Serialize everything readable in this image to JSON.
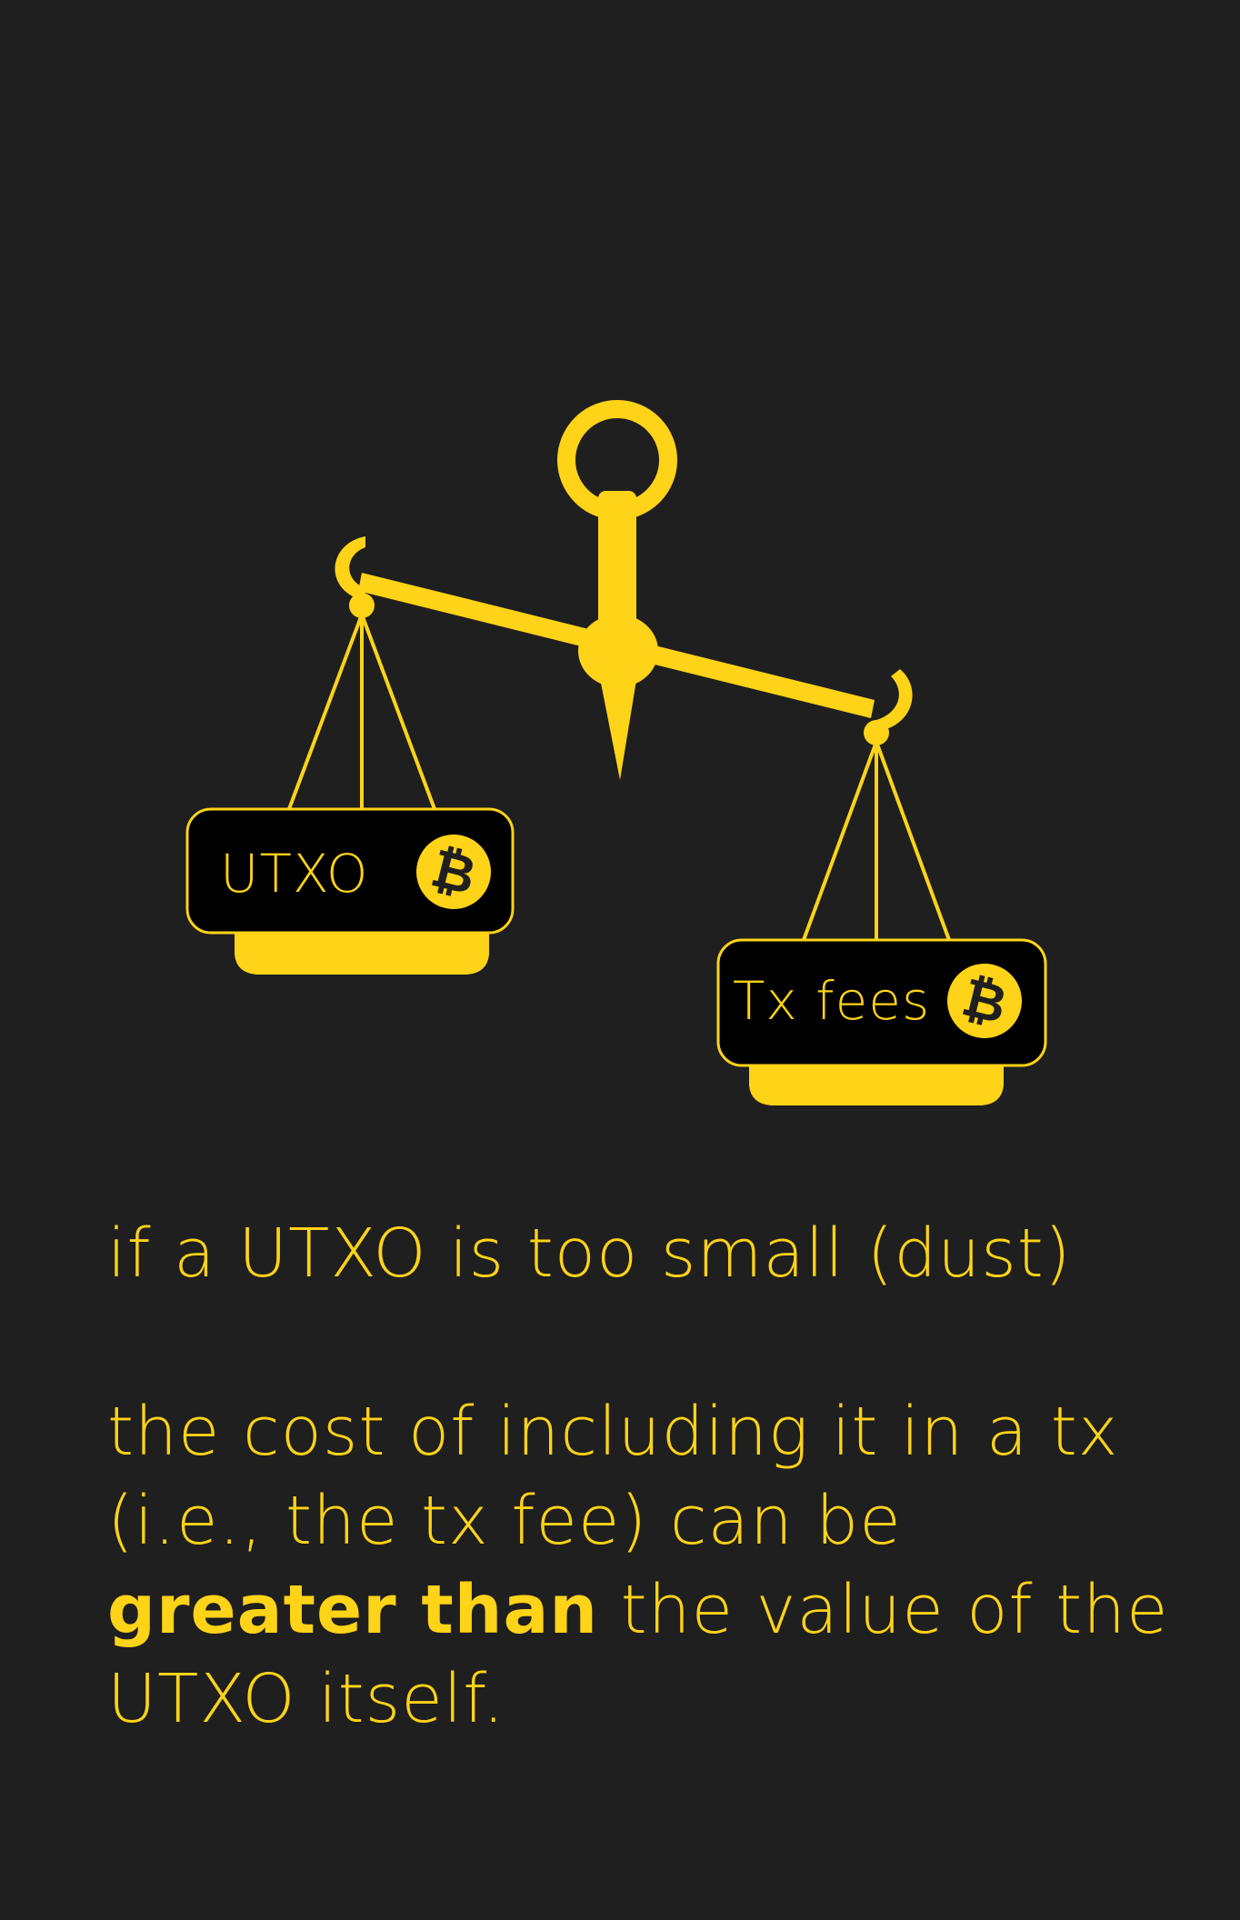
{
  "illustration": {
    "left_pan_label": "UTXO",
    "right_pan_label": "Tx fees",
    "coin_symbol": "₿",
    "icon": "balance-scale-icon",
    "coin_icon": "bitcoin-icon"
  },
  "caption": {
    "line1": "if a UTXO is too small (dust)",
    "para2_lead": "the cost of including it in a tx (i.e., the tx fee) can be",
    "para2_emphasis": "greater than",
    "para2_tail": "the value of the UTXO itself."
  },
  "colors": {
    "background": "#1f1f1f",
    "accent": "#ffd318",
    "pan_fill": "#000000"
  }
}
